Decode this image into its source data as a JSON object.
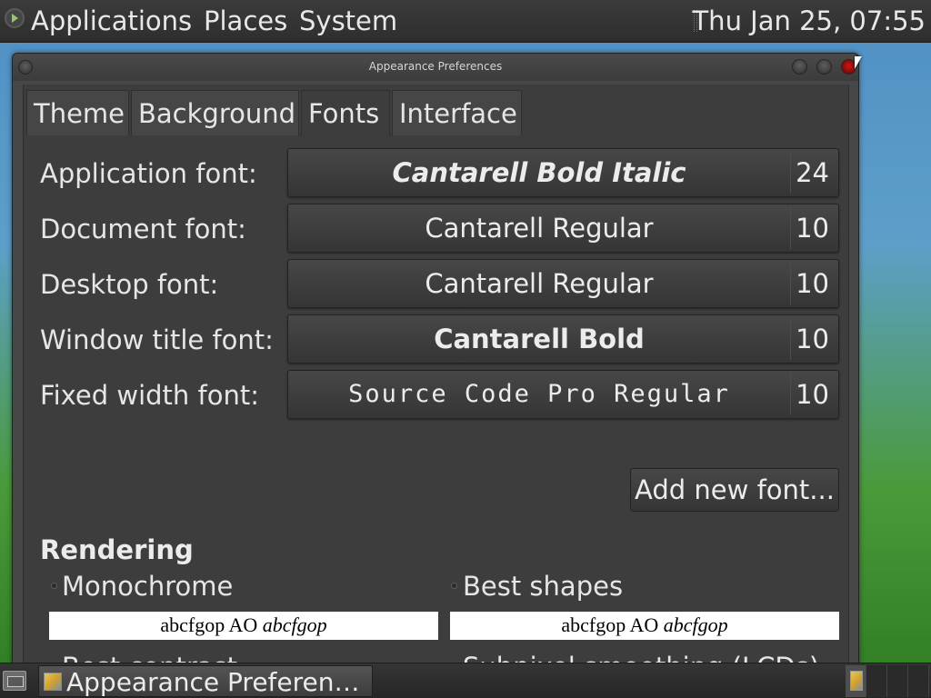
{
  "top_panel": {
    "menus": [
      "Applications",
      "Places",
      "System"
    ],
    "clock": "Thu Jan 25, 07:55"
  },
  "window": {
    "title": "Appearance Preferences",
    "tabs": [
      "Theme",
      "Background",
      "Fonts",
      "Interface"
    ],
    "active_tab": "Fonts",
    "fonts": [
      {
        "label": "Application font:",
        "font": "Cantarell Bold Italic",
        "size": "24"
      },
      {
        "label": "Document font:",
        "font": "Cantarell Regular",
        "size": "10"
      },
      {
        "label": "Desktop font:",
        "font": "Cantarell Regular",
        "size": "10"
      },
      {
        "label": "Window title font:",
        "font": "Cantarell Bold",
        "size": "10"
      },
      {
        "label": "Fixed width font:",
        "font": "Source Code Pro Regular",
        "size": "10"
      }
    ],
    "add_font_label": "Add new font...",
    "rendering": {
      "heading": "Rendering",
      "options": [
        {
          "label": "Monochrome",
          "preview": "abcfgop AO",
          "preview_italic": "abcfgop"
        },
        {
          "label": "Best shapes",
          "preview": "abcfgop AO",
          "preview_italic": "abcfgop"
        },
        {
          "label": "Best contrast"
        },
        {
          "label": "Subpixel smoothing (LCDs)"
        }
      ]
    }
  },
  "bottom_panel": {
    "task_label": "Appearance Preferen…"
  },
  "colors": {
    "panel": "#2e2e2e",
    "window_bg": "#3d3d3d",
    "close_button": "#d01515"
  }
}
